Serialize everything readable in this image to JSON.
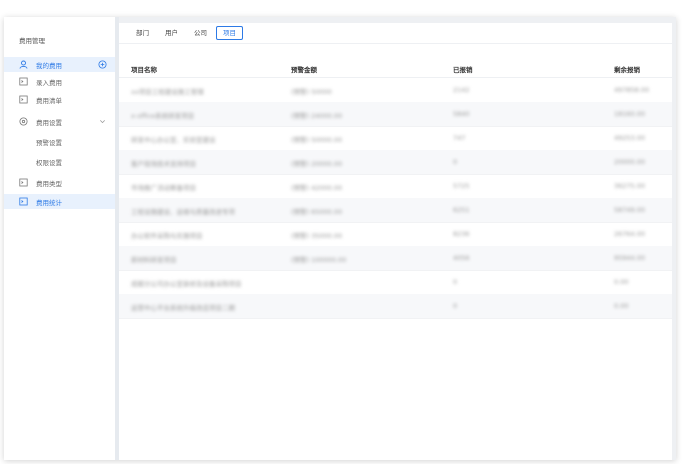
{
  "sidebar": {
    "title": "费用管理",
    "items": [
      {
        "label": "我的费用",
        "icon": "person-icon"
      },
      {
        "label": "录入费用",
        "icon": "form-icon"
      },
      {
        "label": "费用清单",
        "icon": "form-icon"
      },
      {
        "label": "费用设置",
        "icon": "settings-icon"
      },
      {
        "label": "预警设置"
      },
      {
        "label": "权限设置"
      },
      {
        "label": "费用类型",
        "icon": "form-icon"
      },
      {
        "label": "费用统计",
        "icon": "form-icon"
      }
    ]
  },
  "tabs": [
    "部门",
    "用户",
    "公司",
    "项目"
  ],
  "table": {
    "headers": [
      "项目名称",
      "预警金额",
      "已报销",
      "剩余报销"
    ],
    "rows": [
      [
        "xx项目工程建设施工管理",
        "(预警) 50000",
        "2142",
        "497858.00"
      ],
      [
        "x-office系统研发项目",
        "(预警) 24000.00",
        "5840",
        "18160.00"
      ],
      [
        "研发中心办公室、实验室建设",
        "(预警) 50000.00",
        "747",
        "49253.00"
      ],
      [
        "客户现场技术支持项目",
        "(预警) 20000.00",
        "0",
        "20000.00"
      ],
      [
        "市场推广活动筹备项目",
        "(预警) 42000.00",
        "5725",
        "36275.00"
      ],
      [
        "工程设施建设、运维与质量改进专项",
        "(预警) 65000.00",
        "6251",
        "58749.00"
      ],
      [
        "办公软件采购与实施项目",
        "(预警) 35000.00",
        "8236",
        "26764.00"
      ],
      [
        "新材料研发项目",
        "(预警) 100000.00",
        "4056",
        "95944.00"
      ],
      [
        "成都分公司办公室装修及设备采购项目",
        "",
        "0",
        "0.00"
      ],
      [
        "运营中心平台系统升级改造项目二期",
        "",
        "0",
        "0.00"
      ]
    ]
  }
}
